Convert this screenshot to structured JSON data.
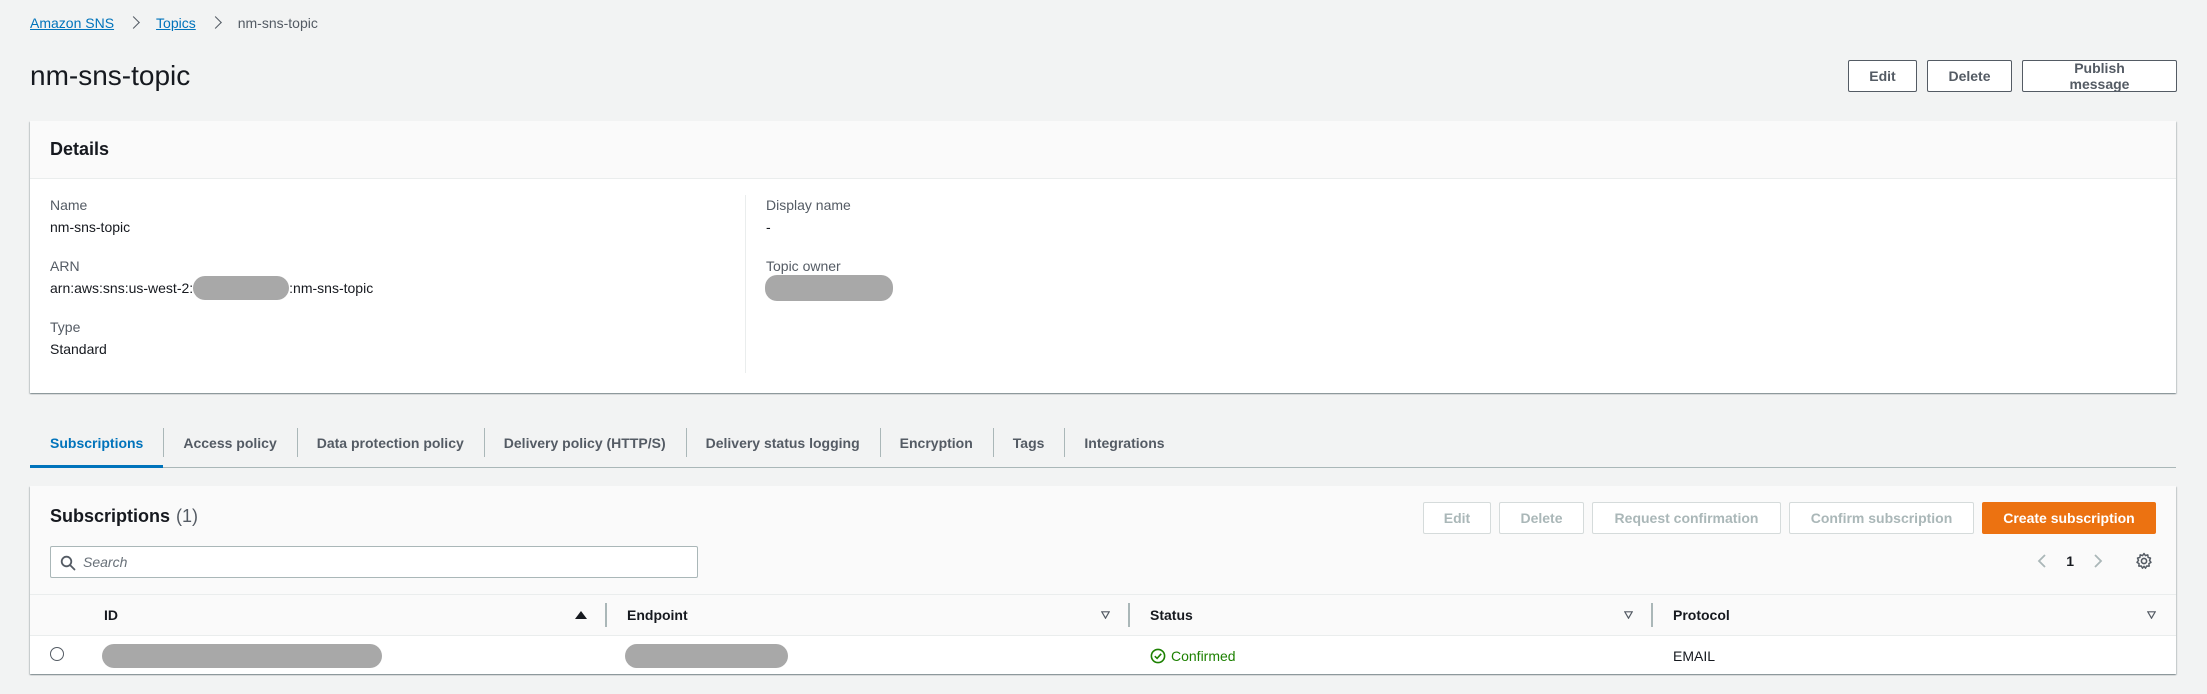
{
  "breadcrumb": {
    "items": [
      "Amazon SNS",
      "Topics"
    ],
    "current": "nm-sns-topic"
  },
  "page": {
    "title": "nm-sns-topic",
    "actions": {
      "edit": "Edit",
      "delete": "Delete",
      "publish": "Publish message"
    }
  },
  "details": {
    "title": "Details",
    "name_label": "Name",
    "name_value": "nm-sns-topic",
    "arn_label": "ARN",
    "arn_prefix": "arn:aws:sns:us-west-2:",
    "arn_suffix": ":nm-sns-topic",
    "type_label": "Type",
    "type_value": "Standard",
    "display_name_label": "Display name",
    "display_name_value": "-",
    "topic_owner_label": "Topic owner"
  },
  "tabs": [
    {
      "label": "Subscriptions",
      "active": true
    },
    {
      "label": "Access policy"
    },
    {
      "label": "Data protection policy"
    },
    {
      "label": "Delivery policy (HTTP/S)"
    },
    {
      "label": "Delivery status logging"
    },
    {
      "label": "Encryption"
    },
    {
      "label": "Tags"
    },
    {
      "label": "Integrations"
    }
  ],
  "subscriptions": {
    "title": "Subscriptions",
    "count": "(1)",
    "actions": {
      "edit": "Edit",
      "delete": "Delete",
      "request_confirmation": "Request confirmation",
      "confirm_subscription": "Confirm subscription",
      "create": "Create subscription"
    },
    "search_placeholder": "Search",
    "page_number": "1",
    "columns": [
      "ID",
      "Endpoint",
      "Status",
      "Protocol"
    ],
    "rows": [
      {
        "status": "Confirmed",
        "protocol": "EMAIL"
      }
    ]
  },
  "colors": {
    "link": "#0073bb",
    "primary_button": "#ec7211",
    "success": "#1d8102",
    "redaction": "#a8a8a8"
  },
  "icons": [
    "chevron-right-icon",
    "search-icon",
    "chevron-left-icon",
    "gear-icon",
    "sort-ascending-icon",
    "sort-descending-icon",
    "check-circle-icon"
  ]
}
